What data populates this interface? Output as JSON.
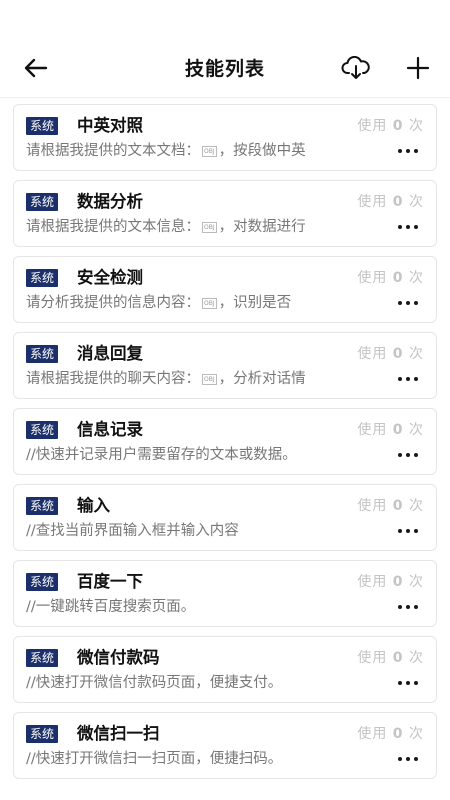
{
  "header": {
    "title": "技能列表",
    "back_icon": "arrow-left-icon",
    "download_icon": "cloud-download-icon",
    "add_icon": "plus-icon"
  },
  "colors": {
    "tag_bg": "#1b2f6b",
    "usage_text": "#c4c4c4",
    "desc_text": "#777777"
  },
  "skills": [
    {
      "tag": "系统",
      "title": "中英对照",
      "usage_prefix": "使用",
      "usage_count": "0",
      "usage_suffix": "次",
      "desc_before": "请根据我提供的文本文档：",
      "obj": "OBJ",
      "desc_after": "，按段做中英"
    },
    {
      "tag": "系统",
      "title": "数据分析",
      "usage_prefix": "使用",
      "usage_count": "0",
      "usage_suffix": "次",
      "desc_before": "请根据我提供的文本信息：",
      "obj": "OBJ",
      "desc_after": "，对数据进行"
    },
    {
      "tag": "系统",
      "title": "安全检测",
      "usage_prefix": "使用",
      "usage_count": "0",
      "usage_suffix": "次",
      "desc_before": "请分析我提供的信息内容：",
      "obj": "OBJ",
      "desc_after": "，识别是否"
    },
    {
      "tag": "系统",
      "title": "消息回复",
      "usage_prefix": "使用",
      "usage_count": "0",
      "usage_suffix": "次",
      "desc_before": "请根据我提供的聊天内容：",
      "obj": "OBJ",
      "desc_after": "，分析对话情"
    },
    {
      "tag": "系统",
      "title": "信息记录",
      "usage_prefix": "使用",
      "usage_count": "0",
      "usage_suffix": "次",
      "desc_before": "//快速并记录用户需要留存的文本或数据。",
      "obj": "",
      "desc_after": ""
    },
    {
      "tag": "系统",
      "title": "输入",
      "usage_prefix": "使用",
      "usage_count": "0",
      "usage_suffix": "次",
      "desc_before": "//查找当前界面输入框并输入内容",
      "obj": "",
      "desc_after": ""
    },
    {
      "tag": "系统",
      "title": "百度一下",
      "usage_prefix": "使用",
      "usage_count": "0",
      "usage_suffix": "次",
      "desc_before": "//一键跳转百度搜索页面。",
      "obj": "",
      "desc_after": ""
    },
    {
      "tag": "系统",
      "title": "微信付款码",
      "usage_prefix": "使用",
      "usage_count": "0",
      "usage_suffix": "次",
      "desc_before": "//快速打开微信付款码页面，便捷支付。",
      "obj": "",
      "desc_after": ""
    },
    {
      "tag": "系统",
      "title": "微信扫一扫",
      "usage_prefix": "使用",
      "usage_count": "0",
      "usage_suffix": "次",
      "desc_before": "//快速打开微信扫一扫页面，便捷扫码。",
      "obj": "",
      "desc_after": ""
    }
  ]
}
